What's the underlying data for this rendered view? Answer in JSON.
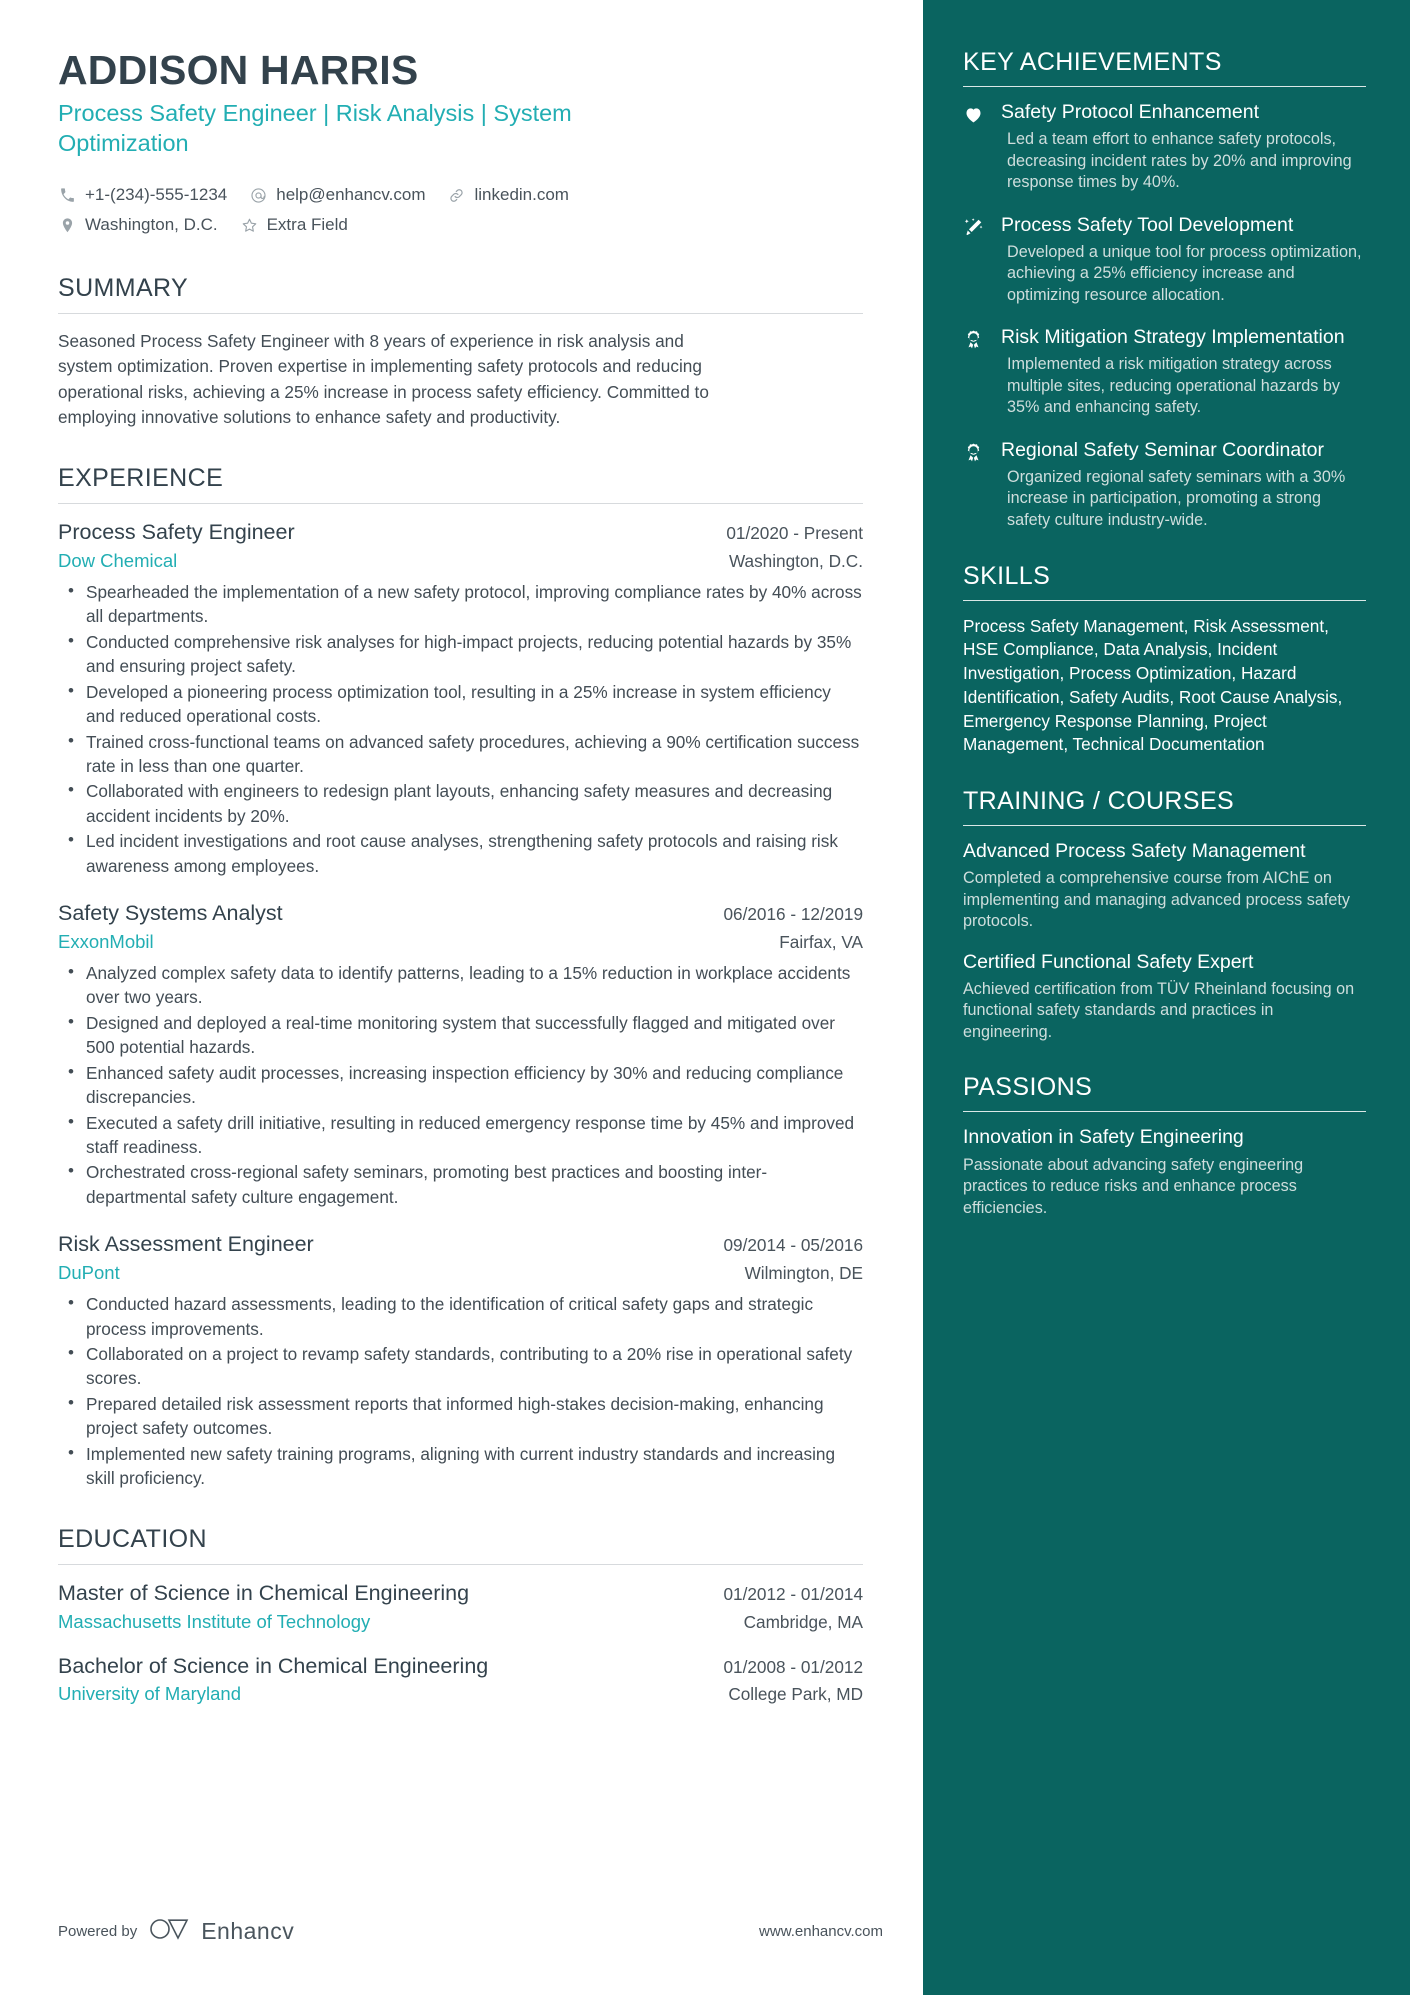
{
  "theme": {
    "accent_teal": "#22aeb3",
    "sidebar_bg": "#0a6460",
    "heading_dark": "#33424c",
    "body_text": "#434d55",
    "sidebar_muted": "#cfdedd"
  },
  "header": {
    "name": "ADDISON HARRIS",
    "headline": "Process Safety Engineer | Risk Analysis | System Optimization",
    "contacts": [
      {
        "icon": "phone-icon",
        "text": "+1-(234)-555-1234"
      },
      {
        "icon": "email-icon",
        "text": "help@enhancv.com"
      },
      {
        "icon": "link-icon",
        "text": "linkedin.com"
      },
      {
        "icon": "location-icon",
        "text": "Washington, D.C."
      },
      {
        "icon": "star-icon",
        "text": "Extra Field"
      }
    ]
  },
  "summary": {
    "title": "SUMMARY",
    "text": "Seasoned Process Safety Engineer with 8 years of experience in risk analysis and system optimization. Proven expertise in implementing safety protocols and reducing operational risks, achieving a 25% increase in process safety efficiency. Committed to employing innovative solutions to enhance safety and productivity."
  },
  "experience": {
    "title": "EXPERIENCE",
    "entries": [
      {
        "role": "Process Safety Engineer",
        "date": "01/2020 - Present",
        "company": "Dow Chemical",
        "location": "Washington, D.C.",
        "bullets": [
          "Spearheaded the implementation of a new safety protocol, improving compliance rates by 40% across all departments.",
          "Conducted comprehensive risk analyses for high-impact projects, reducing potential hazards by 35% and ensuring project safety.",
          "Developed a pioneering process optimization tool, resulting in a 25% increase in system efficiency and reduced operational costs.",
          "Trained cross-functional teams on advanced safety procedures, achieving a 90% certification success rate in less than one quarter.",
          "Collaborated with engineers to redesign plant layouts, enhancing safety measures and decreasing accident incidents by 20%.",
          "Led incident investigations and root cause analyses, strengthening safety protocols and raising risk awareness among employees."
        ]
      },
      {
        "role": "Safety Systems Analyst",
        "date": "06/2016 - 12/2019",
        "company": "ExxonMobil",
        "location": "Fairfax, VA",
        "bullets": [
          "Analyzed complex safety data to identify patterns, leading to a 15% reduction in workplace accidents over two years.",
          "Designed and deployed a real-time monitoring system that successfully flagged and mitigated over 500 potential hazards.",
          "Enhanced safety audit processes, increasing inspection efficiency by 30% and reducing compliance discrepancies.",
          "Executed a safety drill initiative, resulting in reduced emergency response time by 45% and improved staff readiness.",
          "Orchestrated cross-regional safety seminars, promoting best practices and boosting inter-departmental safety culture engagement."
        ]
      },
      {
        "role": "Risk Assessment Engineer",
        "date": "09/2014 - 05/2016",
        "company": "DuPont",
        "location": "Wilmington, DE",
        "bullets": [
          "Conducted hazard assessments, leading to the identification of critical safety gaps and strategic process improvements.",
          "Collaborated on a project to revamp safety standards, contributing to a 20% rise in operational safety scores.",
          "Prepared detailed risk assessment reports that informed high-stakes decision-making, enhancing project safety outcomes.",
          "Implemented new safety training programs, aligning with current industry standards and increasing skill proficiency."
        ]
      }
    ]
  },
  "education": {
    "title": "EDUCATION",
    "entries": [
      {
        "degree": "Master of Science in Chemical Engineering",
        "date": "01/2012 - 01/2014",
        "school": "Massachusetts Institute of Technology",
        "location": "Cambridge, MA"
      },
      {
        "degree": "Bachelor of Science in Chemical Engineering",
        "date": "01/2008 - 01/2012",
        "school": "University of Maryland",
        "location": "College Park, MD"
      }
    ]
  },
  "footer": {
    "powered_by": "Powered by",
    "brand": "Enhancv",
    "url": "www.enhancv.com"
  },
  "sidebar": {
    "achievements": {
      "title": "KEY ACHIEVEMENTS",
      "items": [
        {
          "icon": "heart-icon",
          "title": "Safety Protocol Enhancement",
          "desc": "Led a team effort to enhance safety protocols, decreasing incident rates by 20% and improving response times by 40%."
        },
        {
          "icon": "magic-wand-icon",
          "title": "Process Safety Tool Development",
          "desc": "Developed a unique tool for process optimization, achieving a 25% efficiency increase and optimizing resource allocation."
        },
        {
          "icon": "award-ribbon-icon",
          "title": "Risk Mitigation Strategy Implementation",
          "desc": "Implemented a risk mitigation strategy across multiple sites, reducing operational hazards by 35% and enhancing safety."
        },
        {
          "icon": "award-ribbon-icon",
          "title": "Regional Safety Seminar Coordinator",
          "desc": "Organized regional safety seminars with a 30% increase in participation, promoting a strong safety culture industry-wide."
        }
      ]
    },
    "skills": {
      "title": "SKILLS",
      "text": "Process Safety Management, Risk Assessment, HSE Compliance, Data Analysis, Incident Investigation, Process Optimization, Hazard Identification, Safety Audits, Root Cause Analysis, Emergency Response Planning, Project Management, Technical Documentation"
    },
    "training": {
      "title": "TRAINING / COURSES",
      "items": [
        {
          "title": "Advanced Process Safety Management",
          "desc": "Completed a comprehensive course from AIChE on implementing and managing advanced process safety protocols."
        },
        {
          "title": "Certified Functional Safety Expert",
          "desc": "Achieved certification from TÜV Rheinland focusing on functional safety standards and practices in engineering."
        }
      ]
    },
    "passions": {
      "title": "PASSIONS",
      "items": [
        {
          "title": "Innovation in Safety Engineering",
          "desc": "Passionate about advancing safety engineering practices to reduce risks and enhance process efficiencies."
        }
      ]
    }
  }
}
